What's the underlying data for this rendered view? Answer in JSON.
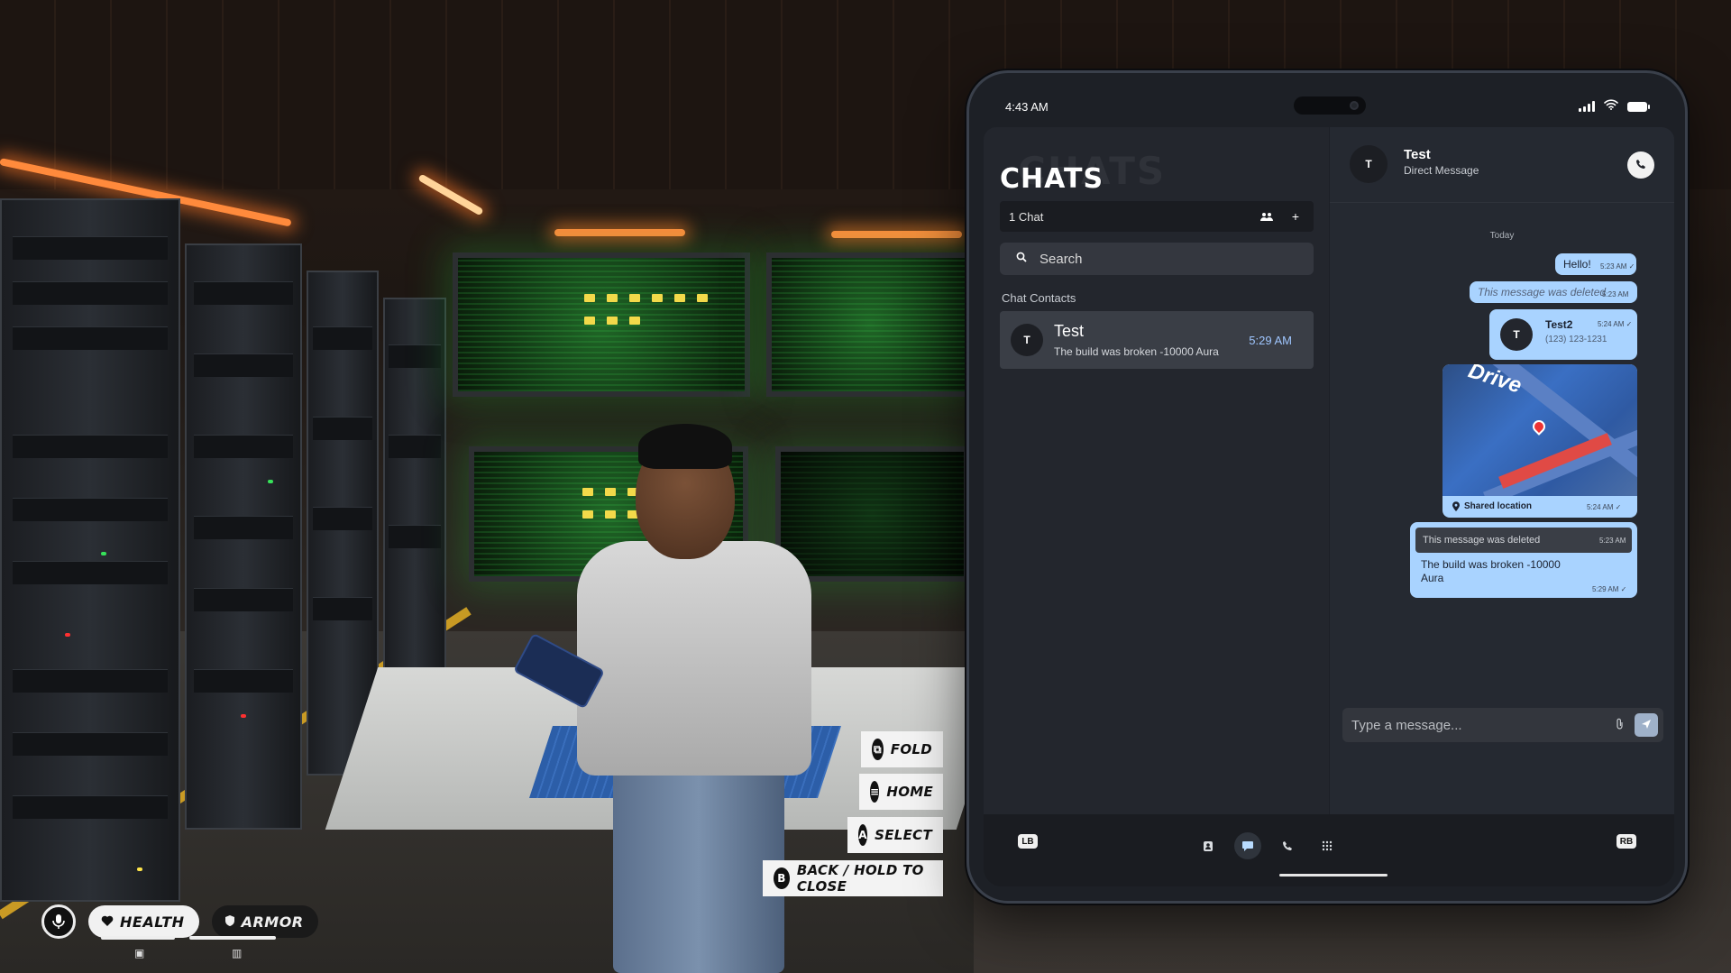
{
  "hud": {
    "health_label": "HEALTH",
    "armor_label": "ARMOR",
    "mic_icon": "microphone-icon"
  },
  "actions": {
    "fold": {
      "key": "",
      "label": "FOLD"
    },
    "home": {
      "key": "",
      "label": "HOME"
    },
    "select": {
      "key": "A",
      "label": "SELECT"
    },
    "back": {
      "key": "B",
      "label": "BACK / HOLD TO CLOSE"
    }
  },
  "phone": {
    "status": {
      "time": "4:43 AM"
    },
    "chats": {
      "ghost_title": "CHATS",
      "title": "CHATS",
      "count": "1 Chat",
      "search_placeholder": "Search",
      "section_label": "Chat Contacts",
      "contacts": [
        {
          "initial": "T",
          "name": "Test",
          "preview": "The build was broken -10000 Aura",
          "time": "5:29 AM"
        }
      ]
    },
    "conversation": {
      "initial": "T",
      "name": "Test",
      "subtitle": "Direct Message",
      "day_separator": "Today",
      "messages": [
        {
          "text": "Hello!",
          "time": "5:23 AM ✓"
        },
        {
          "text": "This message was deleted",
          "time": "5:23 AM"
        },
        {
          "contact_initial": "T",
          "contact_name": "Test2",
          "contact_number": "(123) 123-1231",
          "time": "5:24 AM ✓"
        },
        {
          "map_label": "Drive",
          "caption": "Shared location",
          "time": "5:24 AM ✓"
        },
        {
          "quoted": "This message was deleted",
          "quoted_time": "5:23 AM",
          "text_line1": "The build was broken -10000",
          "text_line2": "Aura",
          "time": "5:29 AM ✓"
        }
      ],
      "input_placeholder": "Type a message..."
    },
    "dock": {
      "lb": "LB",
      "rb": "RB",
      "active_tab": "messages"
    }
  },
  "colors": {
    "bubble": "#a9d3ff",
    "accent_time": "#9fc6ff",
    "phone_bg": "#23262d"
  }
}
